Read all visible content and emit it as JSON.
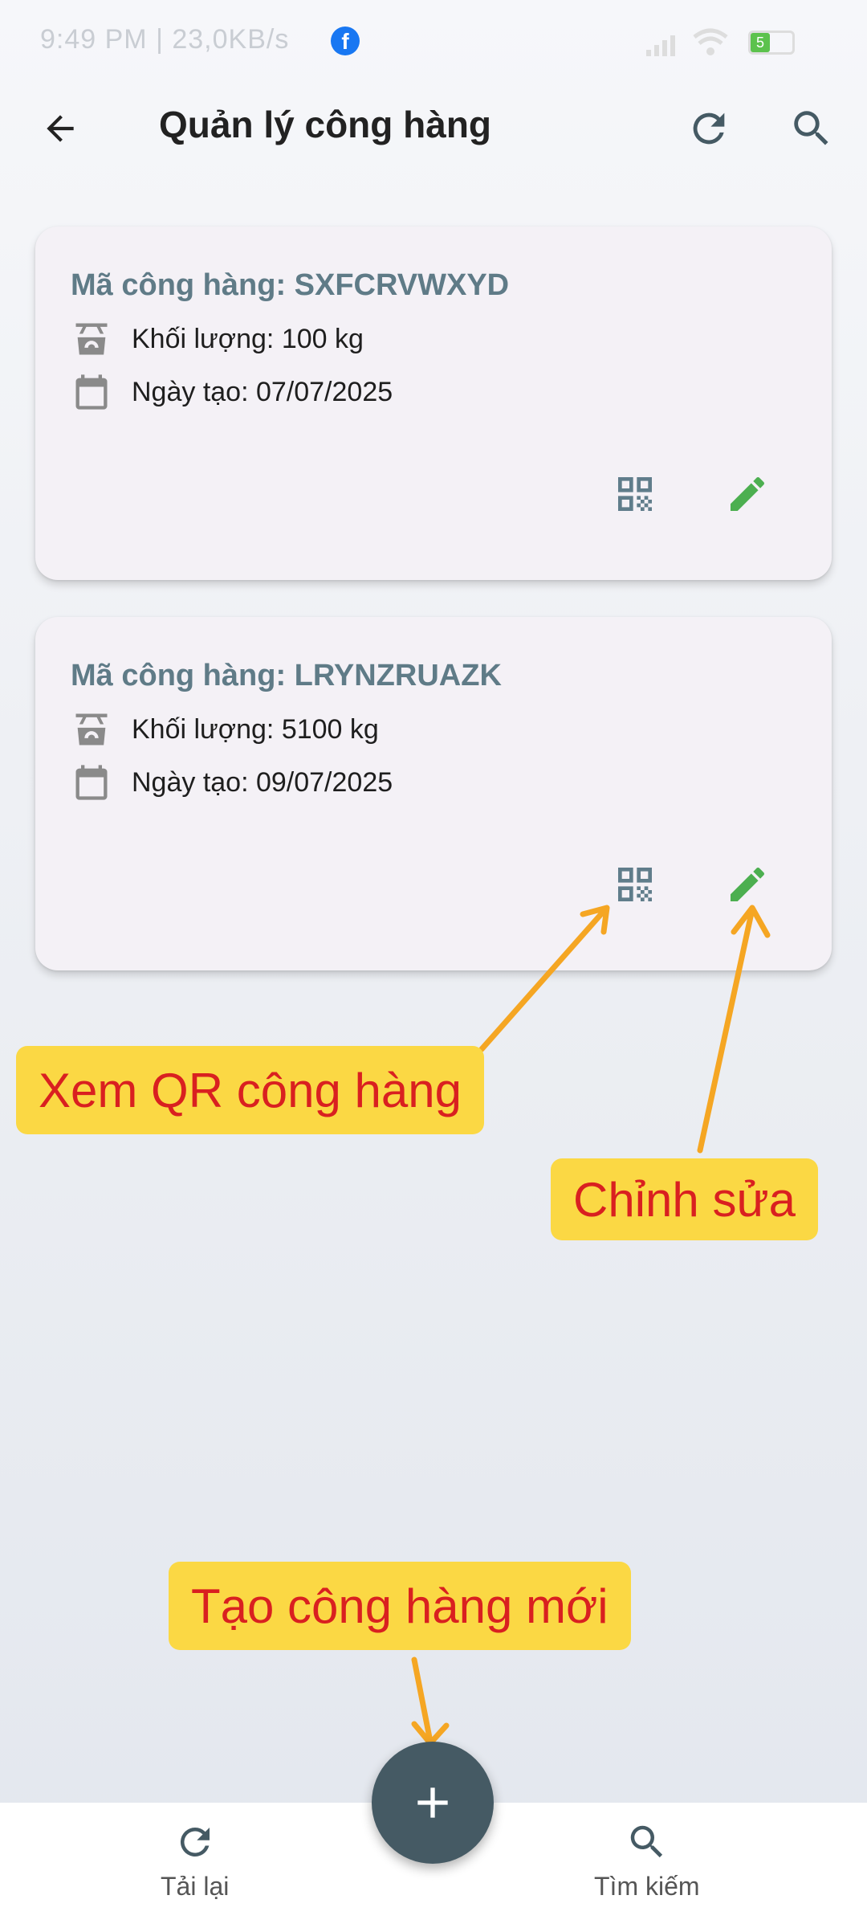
{
  "status_bar": {
    "time_speed": "9:49 PM | 23,0KB/s",
    "battery": "5"
  },
  "app_bar": {
    "title": "Quản lý công hàng"
  },
  "cards": [
    {
      "code": "Mã công hàng: SXFCRVWXYD",
      "weight": "Khối lượng: 100 kg",
      "date": "Ngày tạo: 07/07/2025"
    },
    {
      "code": "Mã công hàng: LRYNZRUAZK",
      "weight": "Khối lượng: 5100 kg",
      "date": "Ngày tạo: 09/07/2025"
    }
  ],
  "annotations": {
    "qr": "Xem QR công hàng",
    "edit": "Chỉnh sửa",
    "create": "Tạo công hàng mới"
  },
  "bottom_nav": {
    "reload": "Tải lại",
    "search": "Tìm kiếm"
  },
  "colors": {
    "accent": "#455a64",
    "code_text": "#5f7b87",
    "edit_icon": "#4caf50",
    "callout_bg": "#fbd844",
    "callout_text": "#d92020",
    "arrow": "#f5a623"
  }
}
